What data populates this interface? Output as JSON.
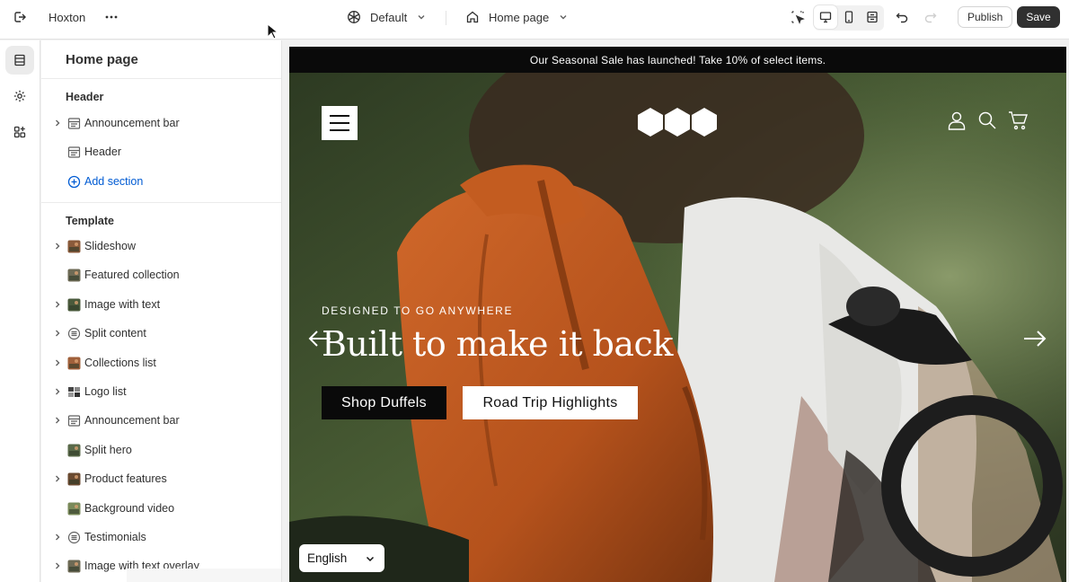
{
  "topbar": {
    "store_name": "Hoxton",
    "theme": "Default",
    "page": "Home page",
    "publish_label": "Publish",
    "save_label": "Save"
  },
  "sidebar": {
    "title": "Home page",
    "header_group": "Header",
    "header_items": [
      {
        "label": "Announcement bar",
        "icon": "section-layout-icon",
        "expandable": true
      },
      {
        "label": "Header",
        "icon": "section-layout-icon",
        "expandable": false
      }
    ],
    "add_section_label": "Add section",
    "template_group": "Template",
    "template_items": [
      {
        "label": "Slideshow",
        "icon": "image-thumb",
        "expandable": true
      },
      {
        "label": "Featured collection",
        "icon": "image-thumb",
        "expandable": false
      },
      {
        "label": "Image with text",
        "icon": "image-thumb",
        "expandable": true
      },
      {
        "label": "Split content",
        "icon": "list-icon",
        "expandable": true
      },
      {
        "label": "Collections list",
        "icon": "image-thumb",
        "expandable": true
      },
      {
        "label": "Logo list",
        "icon": "logo-thumb",
        "expandable": true
      },
      {
        "label": "Announcement bar",
        "icon": "section-layout-icon",
        "expandable": true
      },
      {
        "label": "Split hero",
        "icon": "image-thumb",
        "expandable": false
      },
      {
        "label": "Product features",
        "icon": "image-thumb",
        "expandable": true
      },
      {
        "label": "Background video",
        "icon": "image-thumb",
        "expandable": false
      },
      {
        "label": "Testimonials",
        "icon": "list-icon",
        "expandable": true
      },
      {
        "label": "Image with text overlay",
        "icon": "image-thumb",
        "expandable": true
      }
    ]
  },
  "preview": {
    "announcement": "Our Seasonal Sale has launched! Take 10% of select items.",
    "eyebrow": "DESIGNED TO GO ANYWHERE",
    "headline": "Built to make it back",
    "primary_button": "Shop Duffels",
    "secondary_button": "Road Trip Highlights",
    "language": "English"
  },
  "colors": {
    "accent_link": "#005bd3",
    "save_bg": "#303030",
    "announce_bg": "#0a0a0a"
  }
}
